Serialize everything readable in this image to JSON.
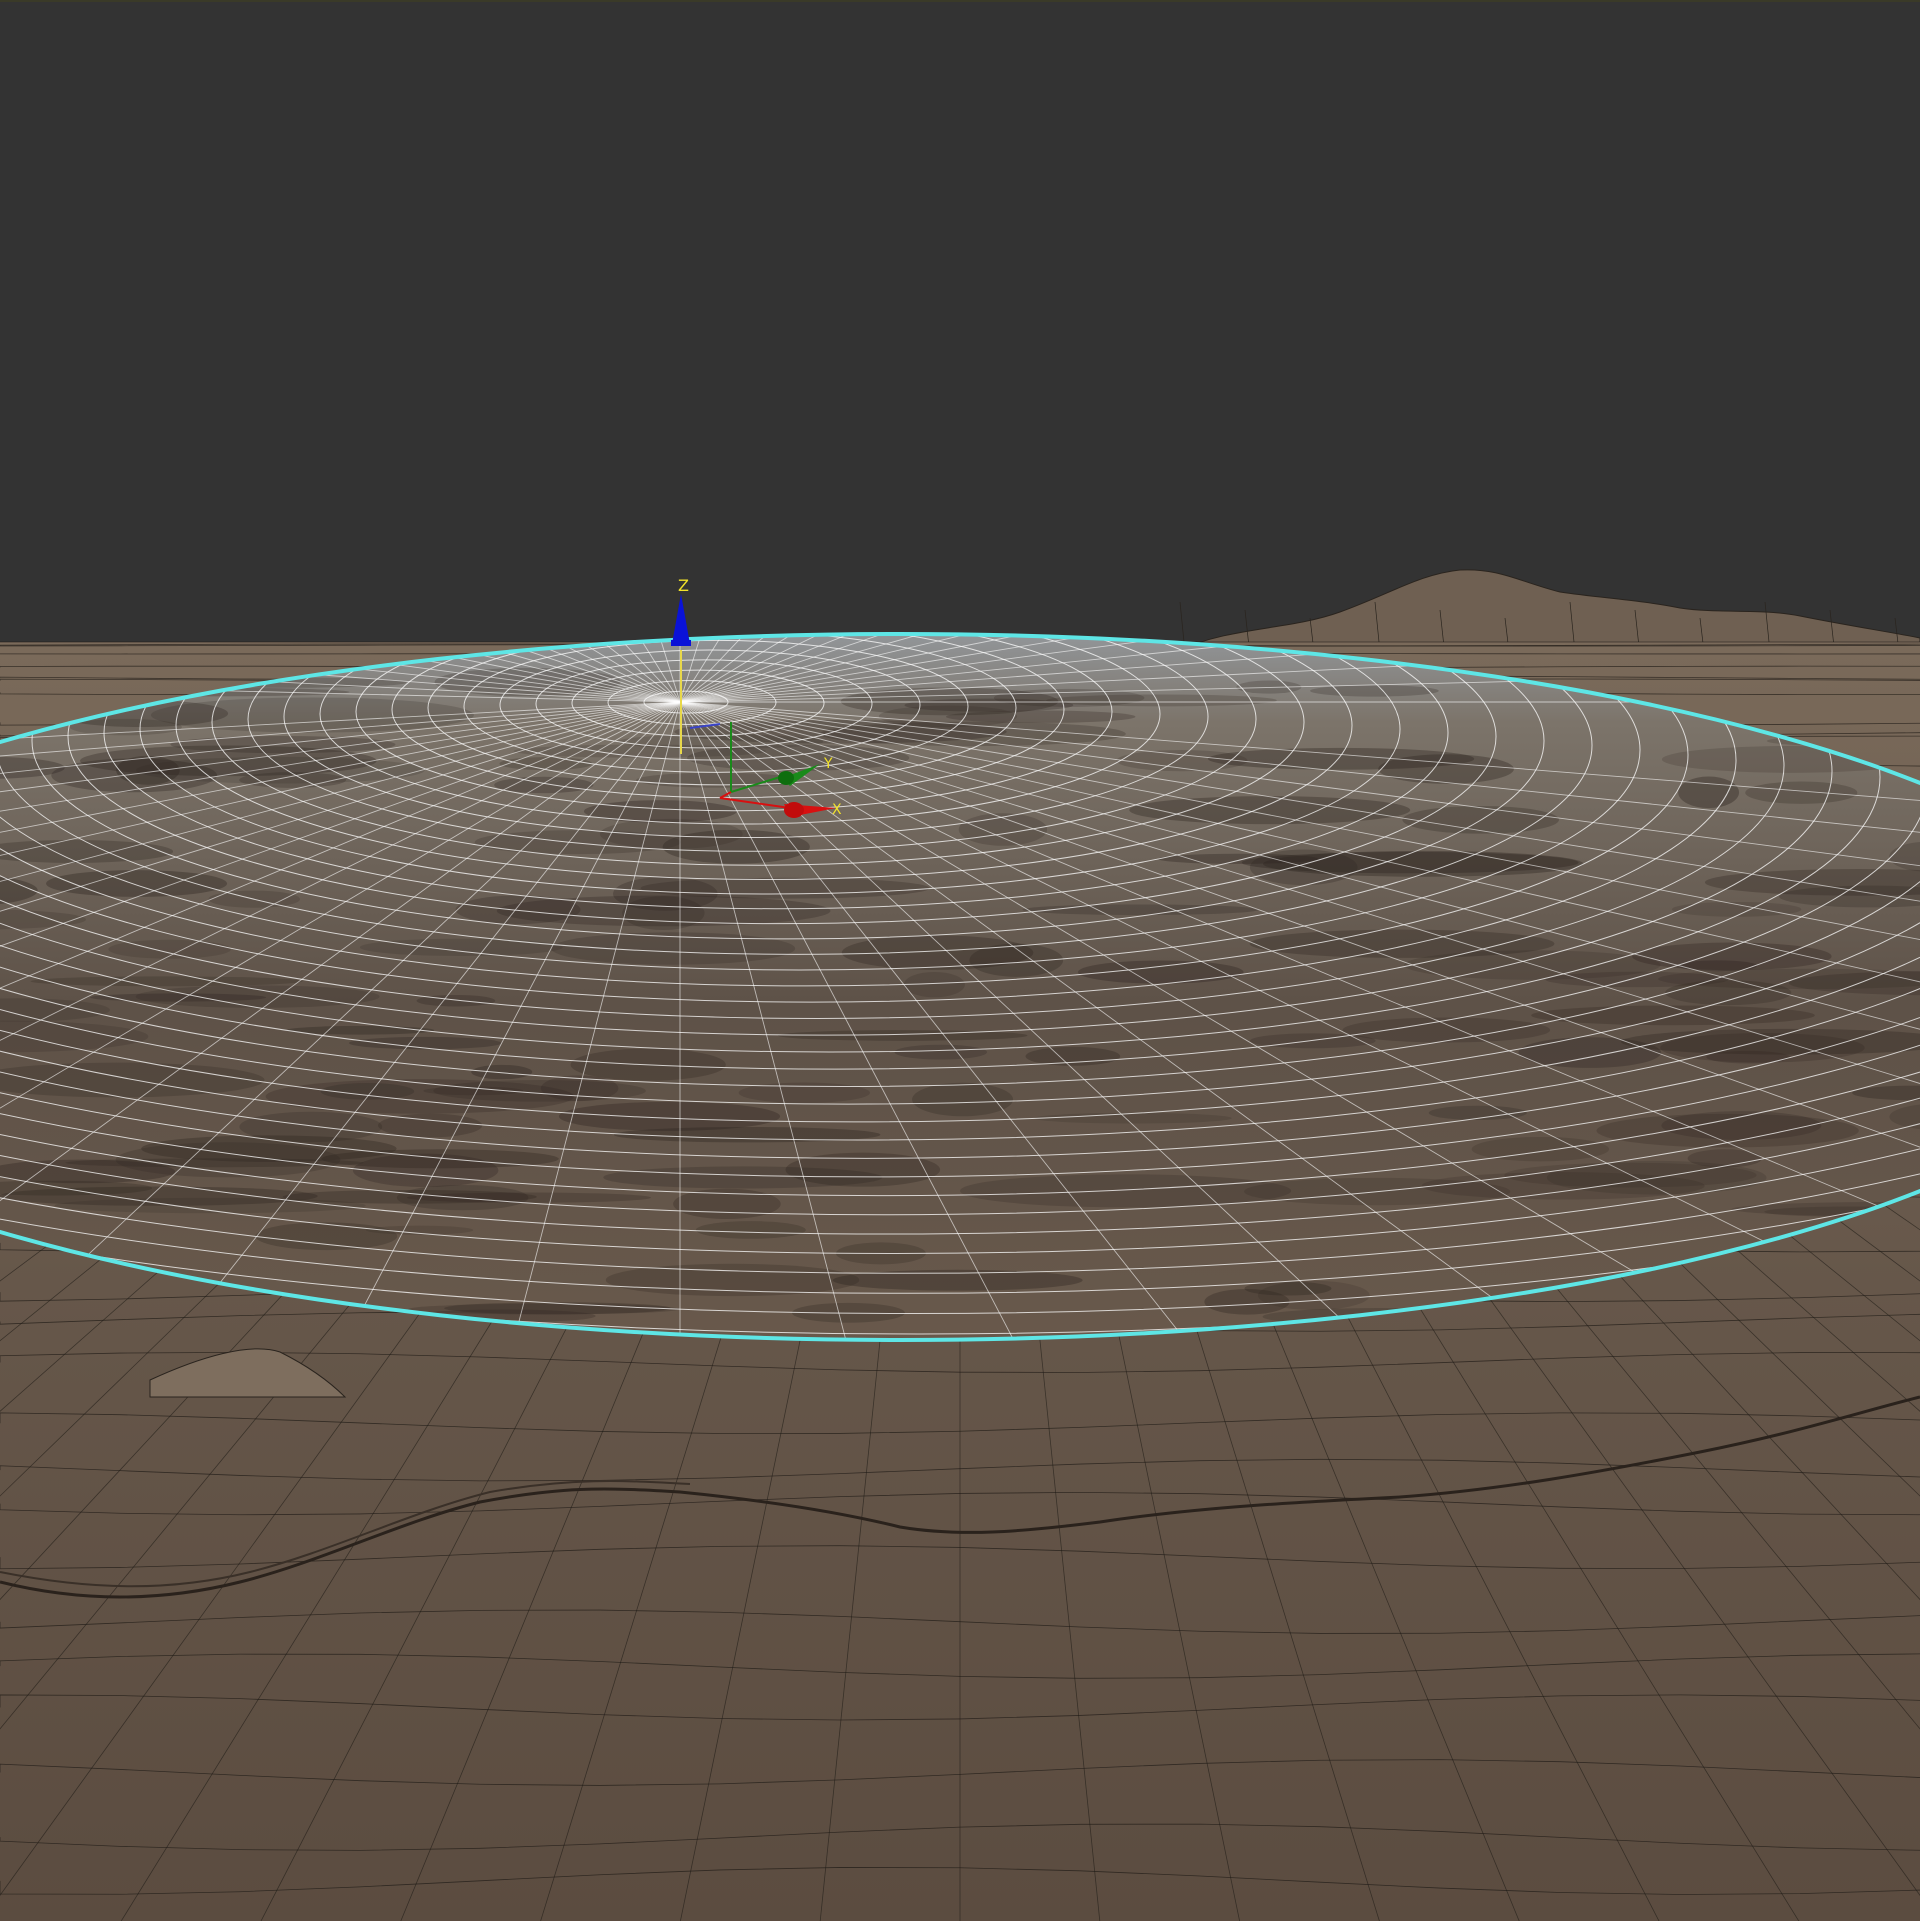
{
  "viewport": {
    "background_color": "#333333",
    "terrain_color": "#5e4f42",
    "terrain_light_color": "#7a6a5a",
    "wire_color": "#1e1a16",
    "selection_color": "#5ee6e6",
    "grid_color": "#ffffff"
  },
  "gizmo": {
    "z_label": "Z",
    "y_label": "Y",
    "x_label": "X",
    "z_color": "#0a12d8",
    "y_color": "#1a8a1a",
    "x_color": "#d81010",
    "label_color": "#f2e22a"
  },
  "icons": {
    "move_gizmo": "move-gizmo-icon",
    "z_arrow": "z-axis-arrow-icon",
    "y_arrow": "y-axis-arrow-icon",
    "x_arrow": "x-axis-arrow-icon"
  }
}
